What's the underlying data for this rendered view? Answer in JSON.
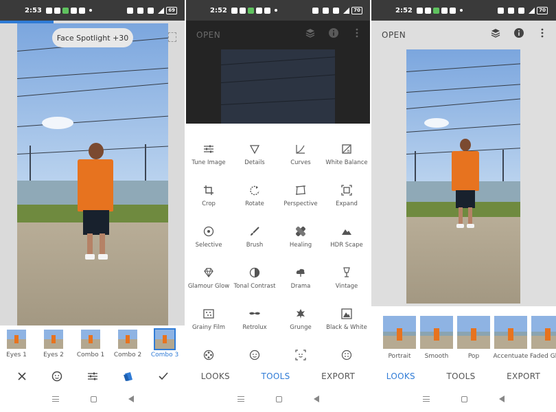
{
  "panels": {
    "editor": {
      "status": {
        "time": "2:53",
        "battery": "69"
      },
      "spotlight_label": "Face Spotlight +30",
      "styles": [
        {
          "label": "Eyes 1",
          "selected": false
        },
        {
          "label": "Eyes 2",
          "selected": false
        },
        {
          "label": "Combo 1",
          "selected": false
        },
        {
          "label": "Combo 2",
          "selected": false
        },
        {
          "label": "Combo 3",
          "selected": true
        }
      ],
      "toolbar": {
        "cancel_icon": "close-icon",
        "face_icon": "face-icon",
        "adjust_icon": "sliders-icon",
        "styles_icon": "styles-icon",
        "apply_icon": "check-icon"
      }
    },
    "tools": {
      "status": {
        "time": "2:52",
        "battery": "70"
      },
      "open_label": "OPEN",
      "tools": [
        {
          "label": "Tune Image",
          "icon": "tune-icon"
        },
        {
          "label": "Details",
          "icon": "details-icon"
        },
        {
          "label": "Curves",
          "icon": "curves-icon"
        },
        {
          "label": "White Balance",
          "icon": "white-balance-icon"
        },
        {
          "label": "Crop",
          "icon": "crop-icon"
        },
        {
          "label": "Rotate",
          "icon": "rotate-icon"
        },
        {
          "label": "Perspective",
          "icon": "perspective-icon"
        },
        {
          "label": "Expand",
          "icon": "expand-icon"
        },
        {
          "label": "Selective",
          "icon": "selective-icon"
        },
        {
          "label": "Brush",
          "icon": "brush-icon"
        },
        {
          "label": "Healing",
          "icon": "healing-icon"
        },
        {
          "label": "HDR Scape",
          "icon": "hdr-icon"
        },
        {
          "label": "Glamour Glow",
          "icon": "glamour-glow-icon"
        },
        {
          "label": "Tonal Contrast",
          "icon": "tonal-contrast-icon"
        },
        {
          "label": "Drama",
          "icon": "drama-icon"
        },
        {
          "label": "Vintage",
          "icon": "vintage-icon"
        },
        {
          "label": "Grainy Film",
          "icon": "grainy-film-icon"
        },
        {
          "label": "Retrolux",
          "icon": "retrolux-icon"
        },
        {
          "label": "Grunge",
          "icon": "grunge-icon"
        },
        {
          "label": "Black & White",
          "icon": "black-white-icon"
        },
        {
          "label": "",
          "icon": "film-reel-icon"
        },
        {
          "label": "",
          "icon": "face-icon"
        },
        {
          "label": "",
          "icon": "face-frame-icon"
        },
        {
          "label": "",
          "icon": "dots-icon"
        }
      ],
      "tabs": [
        "LOOKS",
        "TOOLS",
        "EXPORT"
      ],
      "active_tab": "TOOLS"
    },
    "looks": {
      "status": {
        "time": "2:52",
        "battery": "70"
      },
      "open_label": "OPEN",
      "looks": [
        "Portrait",
        "Smooth",
        "Pop",
        "Accentuate",
        "Faded Gl"
      ],
      "tabs": [
        "LOOKS",
        "TOOLS",
        "EXPORT"
      ],
      "active_tab": "LOOKS"
    }
  },
  "colors": {
    "accent": "#2f7bd6",
    "status_bar": "#3a3a3a"
  }
}
